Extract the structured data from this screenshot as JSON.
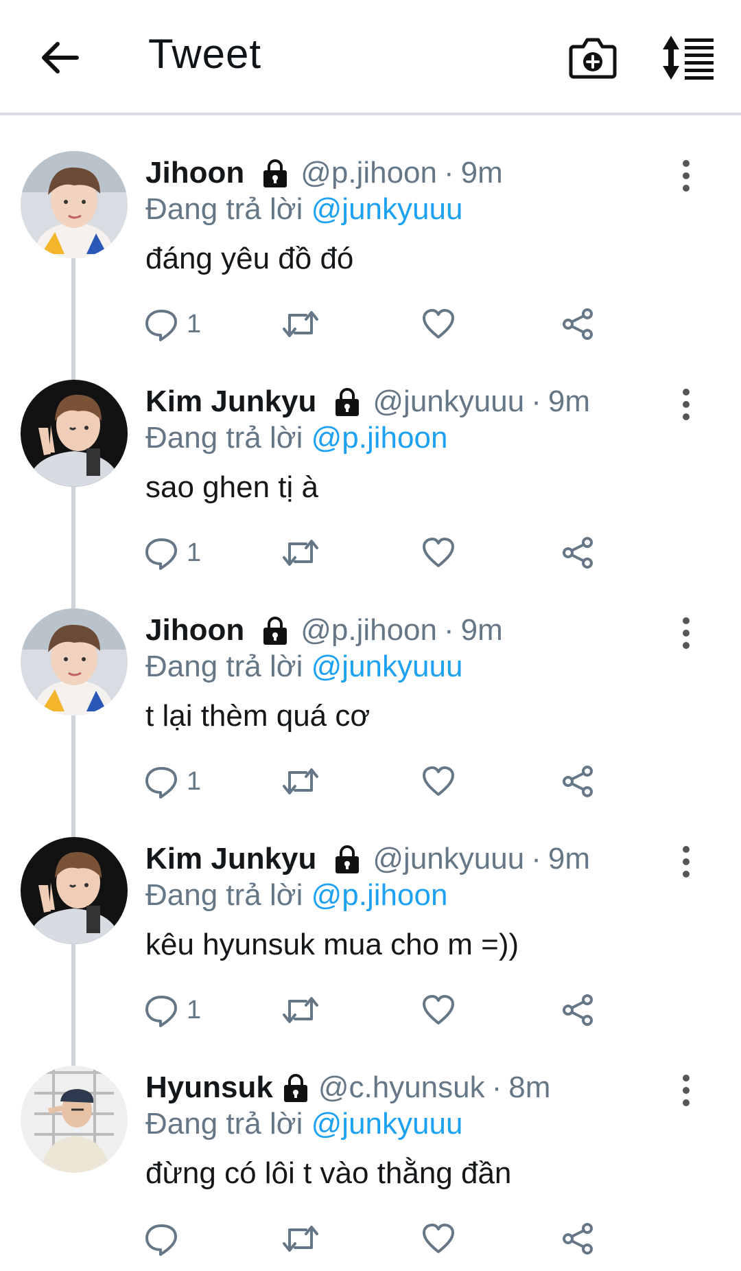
{
  "header": {
    "title": "Tweet",
    "icons": {
      "back": "back-arrow-icon",
      "camera": "camera-icon",
      "sort": "sort-icon"
    }
  },
  "colors": {
    "link": "#1da1f2",
    "secondary": "#657786",
    "text": "#14171a",
    "thread": "#cfd4d9"
  },
  "tweets": [
    {
      "name": "Jihoon",
      "handle": "@p.jihoon",
      "separator": "·",
      "time": "9m",
      "reply_prefix": "Đang trả lời",
      "reply_to": "@junkyuuu",
      "text": "đáng yêu đồ đó",
      "reply_count": "1"
    },
    {
      "name": "Kim Junkyu",
      "handle": "@junkyuuu",
      "separator": "·",
      "time": "9m",
      "reply_prefix": "Đang trả lời",
      "reply_to": "@p.jihoon",
      "text": "sao ghen tị à",
      "reply_count": "1"
    },
    {
      "name": "Jihoon",
      "handle": "@p.jihoon",
      "separator": "·",
      "time": "9m",
      "reply_prefix": "Đang trả lời",
      "reply_to": "@junkyuuu",
      "text": "t lại thèm quá cơ",
      "reply_count": "1"
    },
    {
      "name": "Kim Junkyu",
      "handle": "@junkyuuu",
      "separator": "·",
      "time": "9m",
      "reply_prefix": "Đang trả lời",
      "reply_to": "@p.jihoon",
      "text": "kêu hyunsuk mua cho m =))",
      "reply_count": "1"
    },
    {
      "name": "Hyunsuk",
      "handle": "@c.hyunsuk",
      "separator": "·",
      "time": "8m",
      "reply_prefix": "Đang trả lời",
      "reply_to": "@junkyuuu",
      "text": "đừng có lôi t vào thằng đần",
      "reply_count": ""
    }
  ]
}
